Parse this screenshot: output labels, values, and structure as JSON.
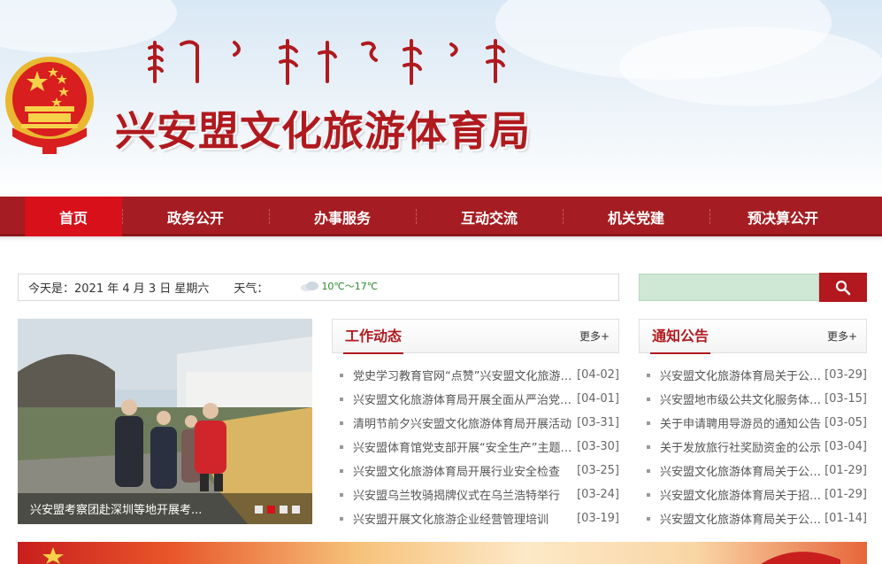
{
  "header": {
    "site_title": "兴安盟文化旅游体育局",
    "emblem_icon": "national-emblem-icon",
    "mongolian_script_icon": "mongolian-script-title"
  },
  "nav": {
    "items": [
      {
        "label": "首页",
        "active": true
      },
      {
        "label": "政务公开"
      },
      {
        "label": "办事服务"
      },
      {
        "label": "互动交流"
      },
      {
        "label": "机关党建"
      },
      {
        "label": "预决算公开"
      }
    ]
  },
  "info_bar": {
    "date_text": "今天是：2021 年 4 月 3 日 星期六",
    "weather_label": "天气：",
    "weather_icon": "cloud-icon",
    "temperature": "10℃～17℃"
  },
  "search": {
    "placeholder": "",
    "button_icon": "search-icon"
  },
  "slider": {
    "caption": "兴安盟考察团赴深圳等地开展考...",
    "dots": 4,
    "active_dot": 2
  },
  "work_news": {
    "title": "工作动态",
    "more": "更多+",
    "items": [
      {
        "title": "党史学习教育官网“点赞”兴安盟文化旅游体育局",
        "date": "[04-02]"
      },
      {
        "title": "兴安盟文化旅游体育局开展全面从严治党工作",
        "date": "[04-01]"
      },
      {
        "title": "清明节前夕兴安盟文化旅游体育局开展活动",
        "date": "[03-31]"
      },
      {
        "title": "兴安盟体育馆党支部开展“安全生产”主题活动",
        "date": "[03-30]"
      },
      {
        "title": "兴安盟文化旅游体育局开展行业安全检查",
        "date": "[03-25]"
      },
      {
        "title": "兴安盟乌兰牧骑揭牌仪式在乌兰浩特举行",
        "date": "[03-24]"
      },
      {
        "title": "兴安盟开展文化旅游企业经营管理培训",
        "date": "[03-19]"
      }
    ]
  },
  "notices": {
    "title": "通知公告",
    "more": "更多+",
    "items": [
      {
        "title": "兴安盟文化旅游体育局关于公示的通知",
        "date": "[03-29]"
      },
      {
        "title": "兴安盟地市级公共文化服务体系示范区",
        "date": "[03-15]"
      },
      {
        "title": "关于申请聘用导游员的通知公告",
        "date": "[03-05]"
      },
      {
        "title": "关于发放旅行社奖励资金的公示",
        "date": "[03-04]"
      },
      {
        "title": "兴安盟文化旅游体育局关于公示的通知",
        "date": "[01-29]"
      },
      {
        "title": "兴安盟文化旅游体育局关于招聘的通知",
        "date": "[01-29]"
      },
      {
        "title": "兴安盟文化旅游体育局关于公布的通知",
        "date": "[01-14]"
      }
    ]
  },
  "colors": {
    "brand_red": "#a51d22",
    "active_red": "#d8101a",
    "search_green": "#cfe8d6"
  }
}
